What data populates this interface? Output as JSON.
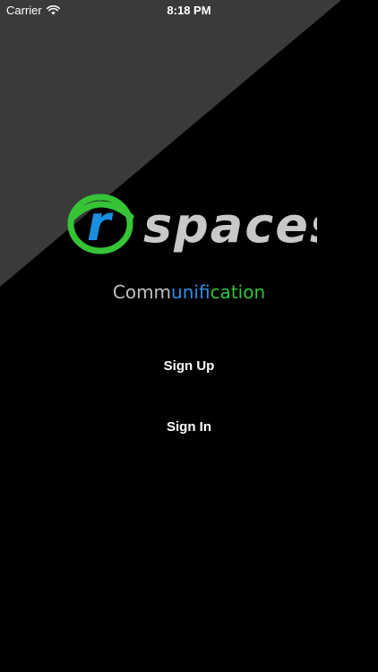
{
  "status_bar": {
    "carrier": "Carrier",
    "time": "8:18 PM",
    "wifi_icon": "wifi-icon"
  },
  "logo": {
    "mark_letter": "r",
    "wordmark": "spaces",
    "ring_color": "#36c436",
    "letter_color": "#1a8fe0",
    "wordmark_color": "#c8c8c8"
  },
  "tagline": {
    "part1": "Comm",
    "part2": "unifi",
    "part3": "cation",
    "color1": "#c0c0c0",
    "color2": "#2f8fe6",
    "color3": "#33c23a"
  },
  "buttons": {
    "sign_up": "Sign Up",
    "sign_in": "Sign In"
  },
  "colors": {
    "background": "#000000",
    "wedge": "#3a3a3a"
  }
}
